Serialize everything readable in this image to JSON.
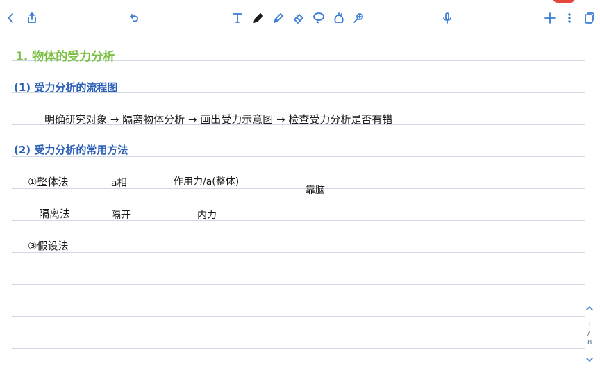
{
  "toolbar": {
    "left": [
      "back-icon",
      "share-icon",
      "undo-icon"
    ],
    "tools": [
      "text-tool-icon",
      "pen-icon",
      "highlighter-icon",
      "eraser-icon",
      "lasso-icon",
      "shape-icon",
      "magic-icon"
    ],
    "right": [
      "mic-icon",
      "add-icon",
      "more-icon",
      "pages-icon"
    ]
  },
  "notes": {
    "title": "1. 物体的受力分析",
    "section1": "(1) 受力分析的流程图",
    "flow": "明确研究对象 → 隔离物体分析 → 画出受力示意图 → 检查受力分析是否有错",
    "section2": "(2) 受力分析的常用方法",
    "m1": "①整体法",
    "m1_col2": "a相",
    "m1_col3": "作用力/a(整体)",
    "side": "靠脑",
    "m2": "隔离法",
    "m2_col2": "隔开",
    "m2_col3": "内力",
    "m3": "③假设法"
  },
  "pager": {
    "current": "1",
    "sep": "/",
    "total": "8"
  }
}
